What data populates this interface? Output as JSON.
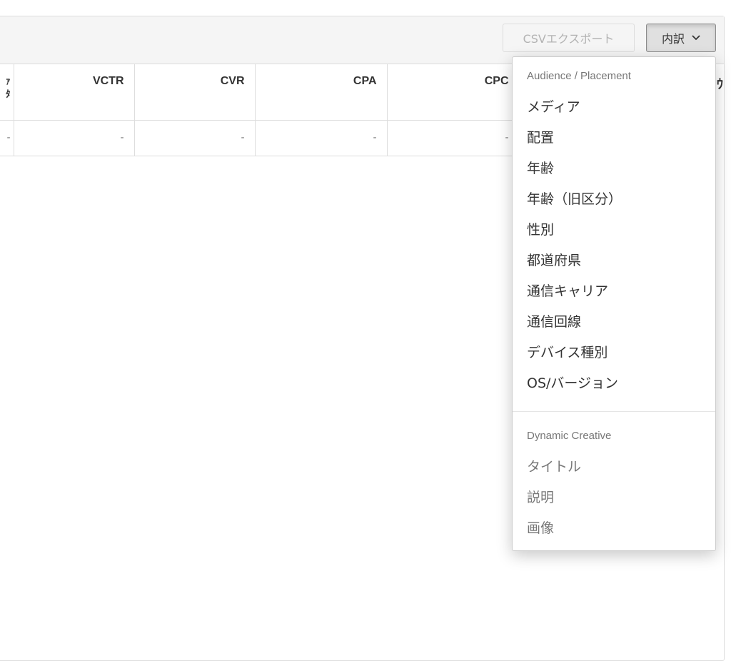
{
  "toolbar": {
    "csv_export_label": "CSVエクスポート",
    "breakdown_label": "内訳",
    "breakdown_icon": "chevron-down-icon"
  },
  "table": {
    "left_cut_header_line1": "ｧ",
    "left_cut_header_line2": "ﾀ",
    "columns": [
      "VCTR",
      "CVR",
      "CPA",
      "CPC"
    ],
    "right_cut_header": "ｳ",
    "rows": [
      {
        "cells": [
          "-",
          "-",
          "-",
          "-",
          "-"
        ]
      }
    ]
  },
  "breakdown_menu": {
    "audience_header": "Audience / Placement",
    "audience_items": [
      "メディア",
      "配置",
      "年齢",
      "年齢（旧区分）",
      "性別",
      "都道府県",
      "通信キャリア",
      "通信回線",
      "デバイス種別",
      "OS/バージョン"
    ],
    "dynamic_header": "Dynamic Creative",
    "dynamic_items": [
      "タイトル",
      "説明",
      "画像"
    ]
  }
}
